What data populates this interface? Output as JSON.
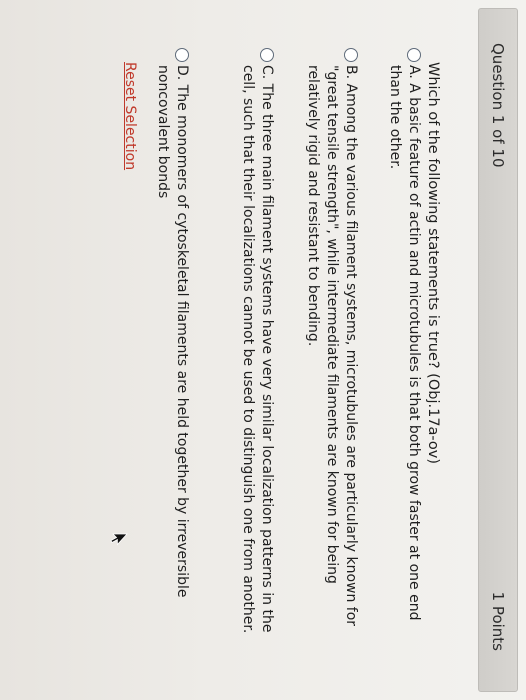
{
  "header": {
    "question_counter": "Question 1 of 10",
    "points": "1 Points"
  },
  "question": {
    "prompt": "Which of the following statements is true? (Obj.17a-ov)",
    "options": [
      {
        "label": "A. A basic feature of actin and microtubules is that both grow faster at one end than the other."
      },
      {
        "label": "B. Among the various filament systems, microtubules are particularly known for \"great tensile strength\", while intermediate filaments are known for being relatively rigid and resistant to bending."
      },
      {
        "label": "C. The three main filament systems have very similar localization patterns in the cell, such that their localizations cannot be used to distinguish one from another."
      },
      {
        "label": "D. The monomers of cytoskeletal filaments are held together by irreversible noncovalent bonds"
      }
    ]
  },
  "reset_link": "Reset Selection",
  "colors": {
    "header_bg": "#d3d1cd",
    "reset_link": "#c0392b",
    "radio_border": "#5f6b7a"
  },
  "icons": {
    "cursor": "mouse-pointer-icon"
  }
}
